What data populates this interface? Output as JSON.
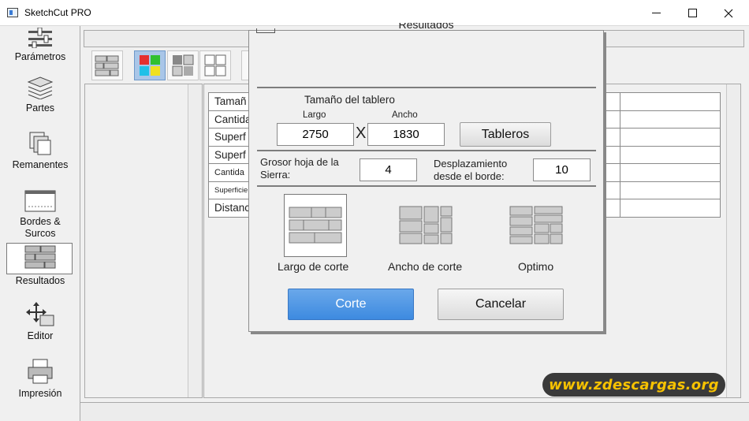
{
  "window": {
    "title": "SketchCut PRO"
  },
  "sidebar": {
    "items": [
      {
        "label": "Parámetros",
        "icon": "sliders-icon"
      },
      {
        "label": "Partes",
        "icon": "layers-icon"
      },
      {
        "label": "Remanentes",
        "icon": "remnants-icon"
      },
      {
        "label": "Bordes &",
        "label2": "Surcos",
        "icon": "edges-icon"
      },
      {
        "label": "Resultados",
        "icon": "results-icon"
      },
      {
        "label": "Editor",
        "icon": "move-icon"
      },
      {
        "label": "Impresión",
        "icon": "printer-icon"
      }
    ]
  },
  "results_table": {
    "rows": [
      "Tamañ",
      "Cantida",
      "Superf",
      "Superf",
      "Cantida",
      "Superficie",
      "Distanc"
    ]
  },
  "dialog": {
    "title": "Resultados",
    "board_size_label": "Tamaño del tablero",
    "length_label": "Largo",
    "width_label": "Ancho",
    "length_value": "2750",
    "times_symbol": "X",
    "width_value": "1830",
    "boards_button": "Tableros",
    "saw_thickness_label": "Grosor hoja de la Sierra:",
    "saw_thickness_value": "4",
    "edge_offset_label": "Desplazamiento desde el borde:",
    "edge_offset_value": "10",
    "options": [
      {
        "label": "Largo de corte",
        "icon": "cut-length-icon",
        "selected": true
      },
      {
        "label": "Ancho de corte",
        "icon": "cut-width-icon",
        "selected": false
      },
      {
        "label": "Optimo",
        "icon": "optimal-icon",
        "selected": false
      }
    ],
    "cut_button": "Corte",
    "cancel_button": "Cancelar"
  },
  "watermark": "www.zdescargas.org",
  "colors": {
    "primary_button": "#3d8ae0",
    "watermark_text": "#f7c200",
    "active_tool": "#a9c6e8"
  }
}
